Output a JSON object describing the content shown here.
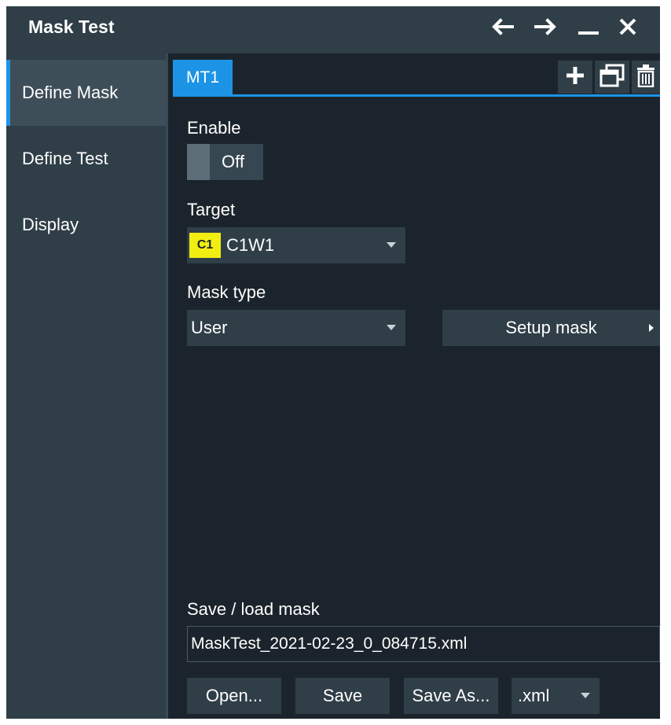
{
  "window": {
    "title": "Mask Test",
    "icons": [
      "arrow-left-icon",
      "arrow-right-icon",
      "minimize-icon",
      "close-icon"
    ]
  },
  "sidebar": {
    "items": [
      {
        "label": "Define Mask",
        "active": true
      },
      {
        "label": "Define Test",
        "active": false
      },
      {
        "label": "Display",
        "active": false
      }
    ]
  },
  "tabs": {
    "items": [
      {
        "label": "MT1",
        "active": true
      }
    ],
    "tools": [
      "add-icon",
      "copy-window-icon",
      "trash-icon"
    ]
  },
  "enable": {
    "label": "Enable",
    "state": "Off"
  },
  "target": {
    "label": "Target",
    "badge": "C1",
    "value": "C1W1"
  },
  "mask_type": {
    "label": "Mask type",
    "value": "User",
    "setup_label": "Setup mask"
  },
  "save_load": {
    "label": "Save / load mask",
    "file_name": "MaskTest_2021-02-23_0_084715.xml",
    "open_label": "Open...",
    "save_label": "Save",
    "save_as_label": "Save As...",
    "format": ".xml"
  },
  "colors": {
    "accent": "#1d93e6",
    "badge": "#f3ee12",
    "background": "#1b242c",
    "panel": "#2f3e47"
  }
}
